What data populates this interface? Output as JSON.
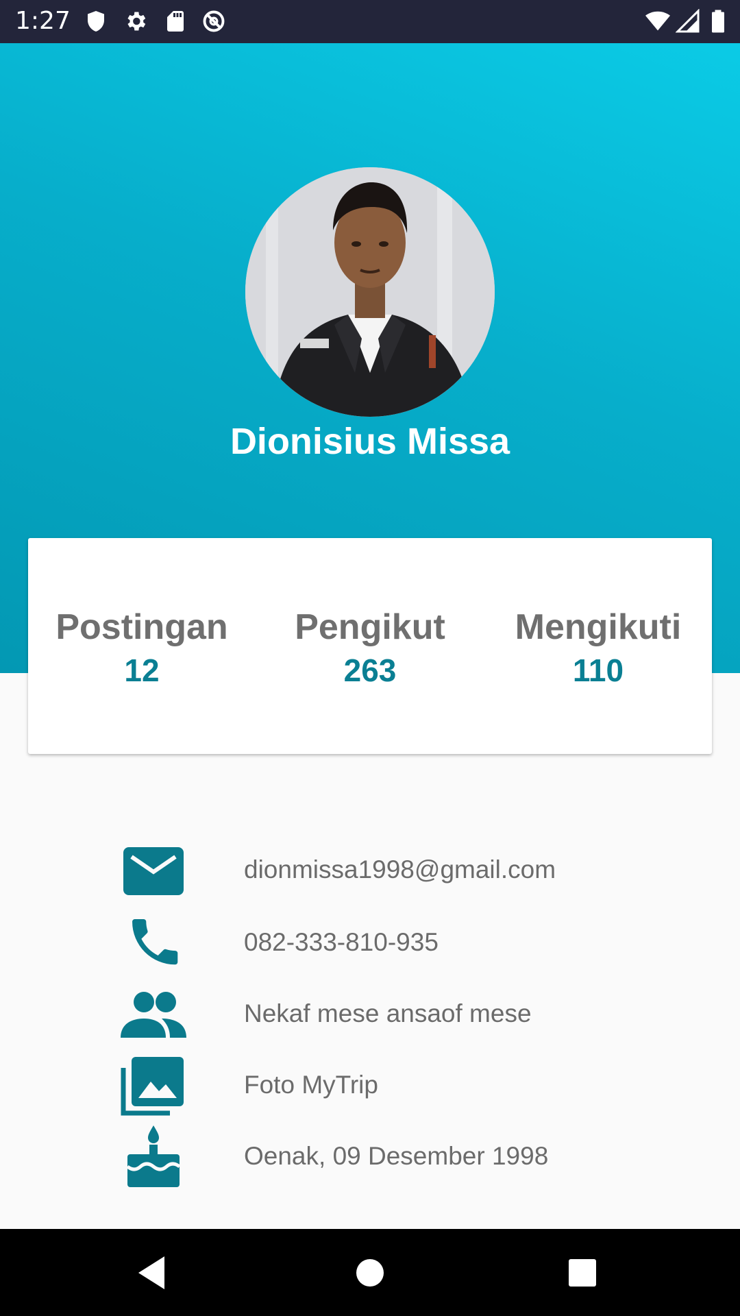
{
  "status_bar": {
    "time": "1:27",
    "left_icons": [
      "shield-icon",
      "gear-icon",
      "sd-card-icon",
      "do-not-disturb-icon"
    ],
    "right_icons": [
      "wifi-icon",
      "signal-icon",
      "battery-icon"
    ]
  },
  "profile": {
    "name": "Dionisius Missa",
    "avatar_icon": "profile-photo"
  },
  "stats": [
    {
      "label": "Postingan",
      "value": "12"
    },
    {
      "label": "Pengikut",
      "value": "263"
    },
    {
      "label": "Mengikuti",
      "value": "110"
    }
  ],
  "info": [
    {
      "icon": "email-icon",
      "text": "dionmissa1998@gmail.com"
    },
    {
      "icon": "phone-icon",
      "text": "082-333-810-935"
    },
    {
      "icon": "people-icon",
      "text": "Nekaf mese ansaof mese"
    },
    {
      "icon": "photo-library-icon",
      "text": "Foto MyTrip"
    },
    {
      "icon": "cake-icon",
      "text": "Oenak, 09 Desember 1998"
    }
  ],
  "nav_bar": {
    "buttons": [
      "back-icon",
      "home-icon",
      "recents-icon"
    ]
  },
  "colors": {
    "status_bar": "#23253a",
    "header_light": "#0bcbe6",
    "header_dark": "#0398b3",
    "stat_value": "#0a7f93",
    "icon": "#0b7a8c",
    "info_text": "#6b6b6b"
  }
}
